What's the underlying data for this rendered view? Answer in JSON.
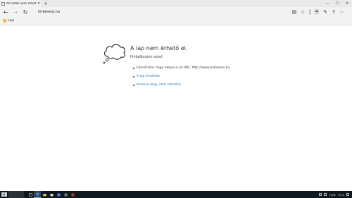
{
  "browser": {
    "tab_title": "Az oldal nem érhető el",
    "address": "hirkereso.hu",
    "favorites_item": "Lapi"
  },
  "error": {
    "title": "A lap nem érhető el.",
    "subtitle": "Próbálkozzon ezzel:",
    "items": [
      "Ellenőrizze, hogy helyes-e az URL: http://www.hirkereso.hu",
      "A lap frissítése",
      "Keresse meg, amit szeretne"
    ]
  },
  "taskbar": {
    "language": "HUN",
    "time": "9:33"
  },
  "colors": {
    "link": "#1a6fbd",
    "taskbar_bg": "#101820"
  },
  "icons": {
    "back": "back-arrow-icon",
    "forward": "forward-arrow-icon",
    "refresh": "refresh-icon",
    "favorite": "star-icon",
    "error": "thought-cloud-icon"
  }
}
